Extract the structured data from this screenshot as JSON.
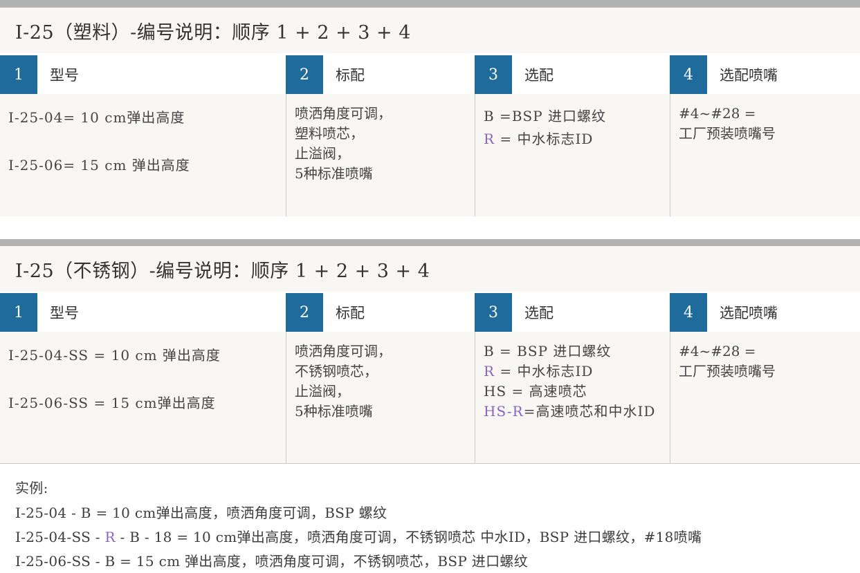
{
  "section1": {
    "title": "I-25（塑料）-编号说明：顺序 1 + 2 + 3 + 4",
    "headers": [
      {
        "num": "1",
        "label": "型号"
      },
      {
        "num": "2",
        "label": "标配"
      },
      {
        "num": "3",
        "label": "选配"
      },
      {
        "num": "4",
        "label": "选配喷嘴"
      }
    ],
    "col1": [
      "I-25-04= 10 cm弹出高度",
      "I-25-06= 15 cm 弹出高度"
    ],
    "col2": [
      "喷洒角度可调，",
      "塑料喷芯，",
      "止溢阀，",
      "5种标准喷嘴"
    ],
    "col3": {
      "b": "B =BSP 进口螺纹",
      "r_code": "R",
      "r_text": " = 中水标志ID"
    },
    "col4": [
      "#4~#28 =",
      "工厂预装喷嘴号"
    ]
  },
  "section2": {
    "title": "I-25（不锈钢）-编号说明：顺序 1 + 2 + 3 + 4",
    "headers": [
      {
        "num": "1",
        "label": "型号"
      },
      {
        "num": "2",
        "label": "标配"
      },
      {
        "num": "3",
        "label": "选配"
      },
      {
        "num": "4",
        "label": "选配喷嘴"
      }
    ],
    "col1": [
      "I-25-04-SS = 10 cm 弹出高度",
      "I-25-06-SS = 15 cm弹出高度"
    ],
    "col2": [
      "喷洒角度可调，",
      "不锈钢喷芯，",
      "止溢阀，",
      "5种标准喷嘴"
    ],
    "col3": {
      "b": "B = BSP 进口螺纹",
      "r_code": "R",
      "r_text": " = 中水标志ID",
      "hs": "HS = 高速喷芯",
      "hsr_code": "HS-R",
      "hsr_text": "=高速喷芯和中水ID"
    },
    "col4": [
      "#4~#28 =",
      "工厂预装喷嘴号"
    ]
  },
  "examples": {
    "label": "实例:",
    "line1": "I-25-04 - B = 10 cm弹出高度，喷洒角度可调，BSP 螺纹",
    "line2_a": "I-25-04-SS - ",
    "line2_r": "R",
    "line2_b": " - B - 18 = 10 cm弹出高度，喷洒角度可调，不锈钢喷芯 中水ID，BSP 进口螺纹，#18喷嘴",
    "line3": "I-25-06-SS - B = 15 cm 弹出高度，喷洒角度可调，不锈钢喷芯，BSP 进口螺纹"
  },
  "colors": {
    "accent_blue": "#1f6b9c",
    "purple": "#8a63c4",
    "bar_gray": "#b3b3b3"
  }
}
